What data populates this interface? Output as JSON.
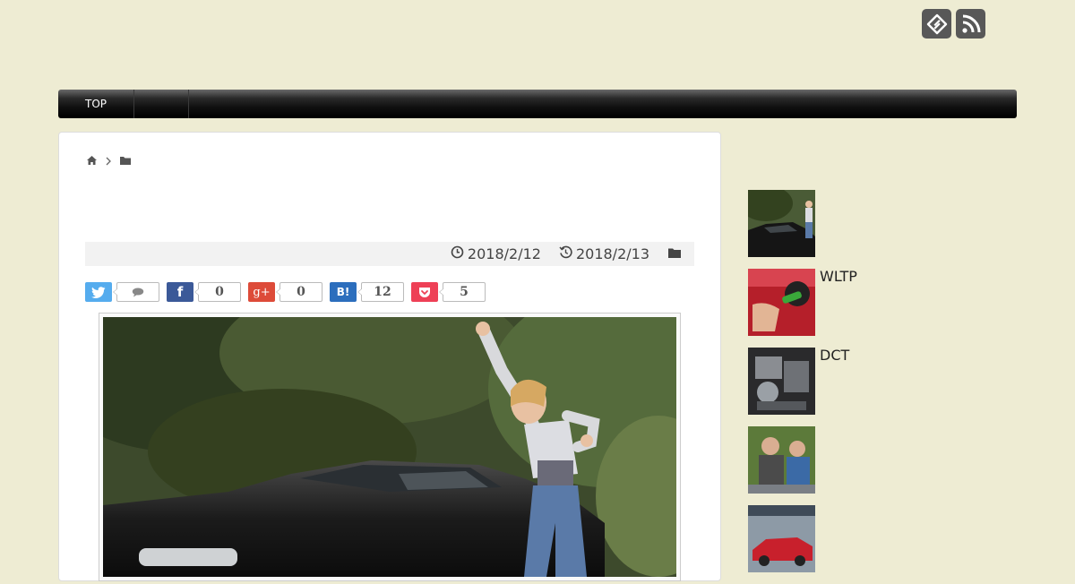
{
  "header": {
    "icons": [
      "feedly-icon",
      "rss-icon"
    ]
  },
  "nav": {
    "items": [
      "TOP",
      ""
    ]
  },
  "breadcrumb": {
    "icons": [
      "home-icon",
      "chevron-right-icon",
      "folder-icon"
    ]
  },
  "post": {
    "published": "2018/2/12",
    "updated": "2018/2/13"
  },
  "share": {
    "twitter": {
      "label": "",
      "count": ""
    },
    "facebook": {
      "label": "f",
      "count": "0"
    },
    "googleplus": {
      "label": "g+",
      "count": "0"
    },
    "hatena": {
      "label": "B!",
      "count": "12"
    },
    "pocket": {
      "label": "",
      "count": "5"
    }
  },
  "colors": {
    "background": "#eeecd3",
    "twitter": "#55acee",
    "facebook": "#3b5998",
    "googleplus": "#dd4b39",
    "hatena": "#2c6ebd",
    "pocket": "#ee4056"
  },
  "sidebar": {
    "items": [
      {
        "title": ""
      },
      {
        "title": "WLTP"
      },
      {
        "title": "DCT"
      },
      {
        "title": ""
      },
      {
        "title": ""
      }
    ]
  }
}
